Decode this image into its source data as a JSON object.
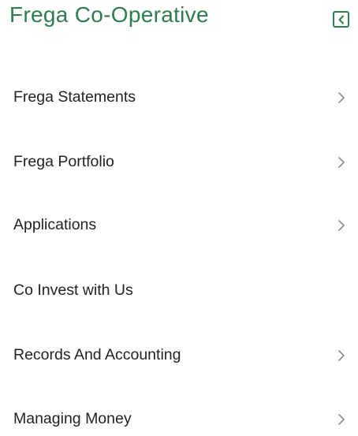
{
  "header": {
    "title": "Frega Co-Operative",
    "collapse_icon": "chevron-left-square-icon"
  },
  "colors": {
    "brand_green": "#2e7d4f",
    "text": "#222222",
    "chevron": "#8a8a8a",
    "background": "#ffffff"
  },
  "menu": {
    "items": [
      {
        "label": "Frega Statements",
        "icon": "chevron-right-icon"
      },
      {
        "label": "Frega Portfolio",
        "icon": "chevron-right-icon"
      },
      {
        "label": "Applications",
        "icon": "chevron-right-icon"
      },
      {
        "label": "Co Invest with Us"
      },
      {
        "label": "Records And Accounting",
        "icon": "chevron-right-icon"
      },
      {
        "label": "Managing Money",
        "icon": "chevron-right-icon"
      }
    ]
  }
}
